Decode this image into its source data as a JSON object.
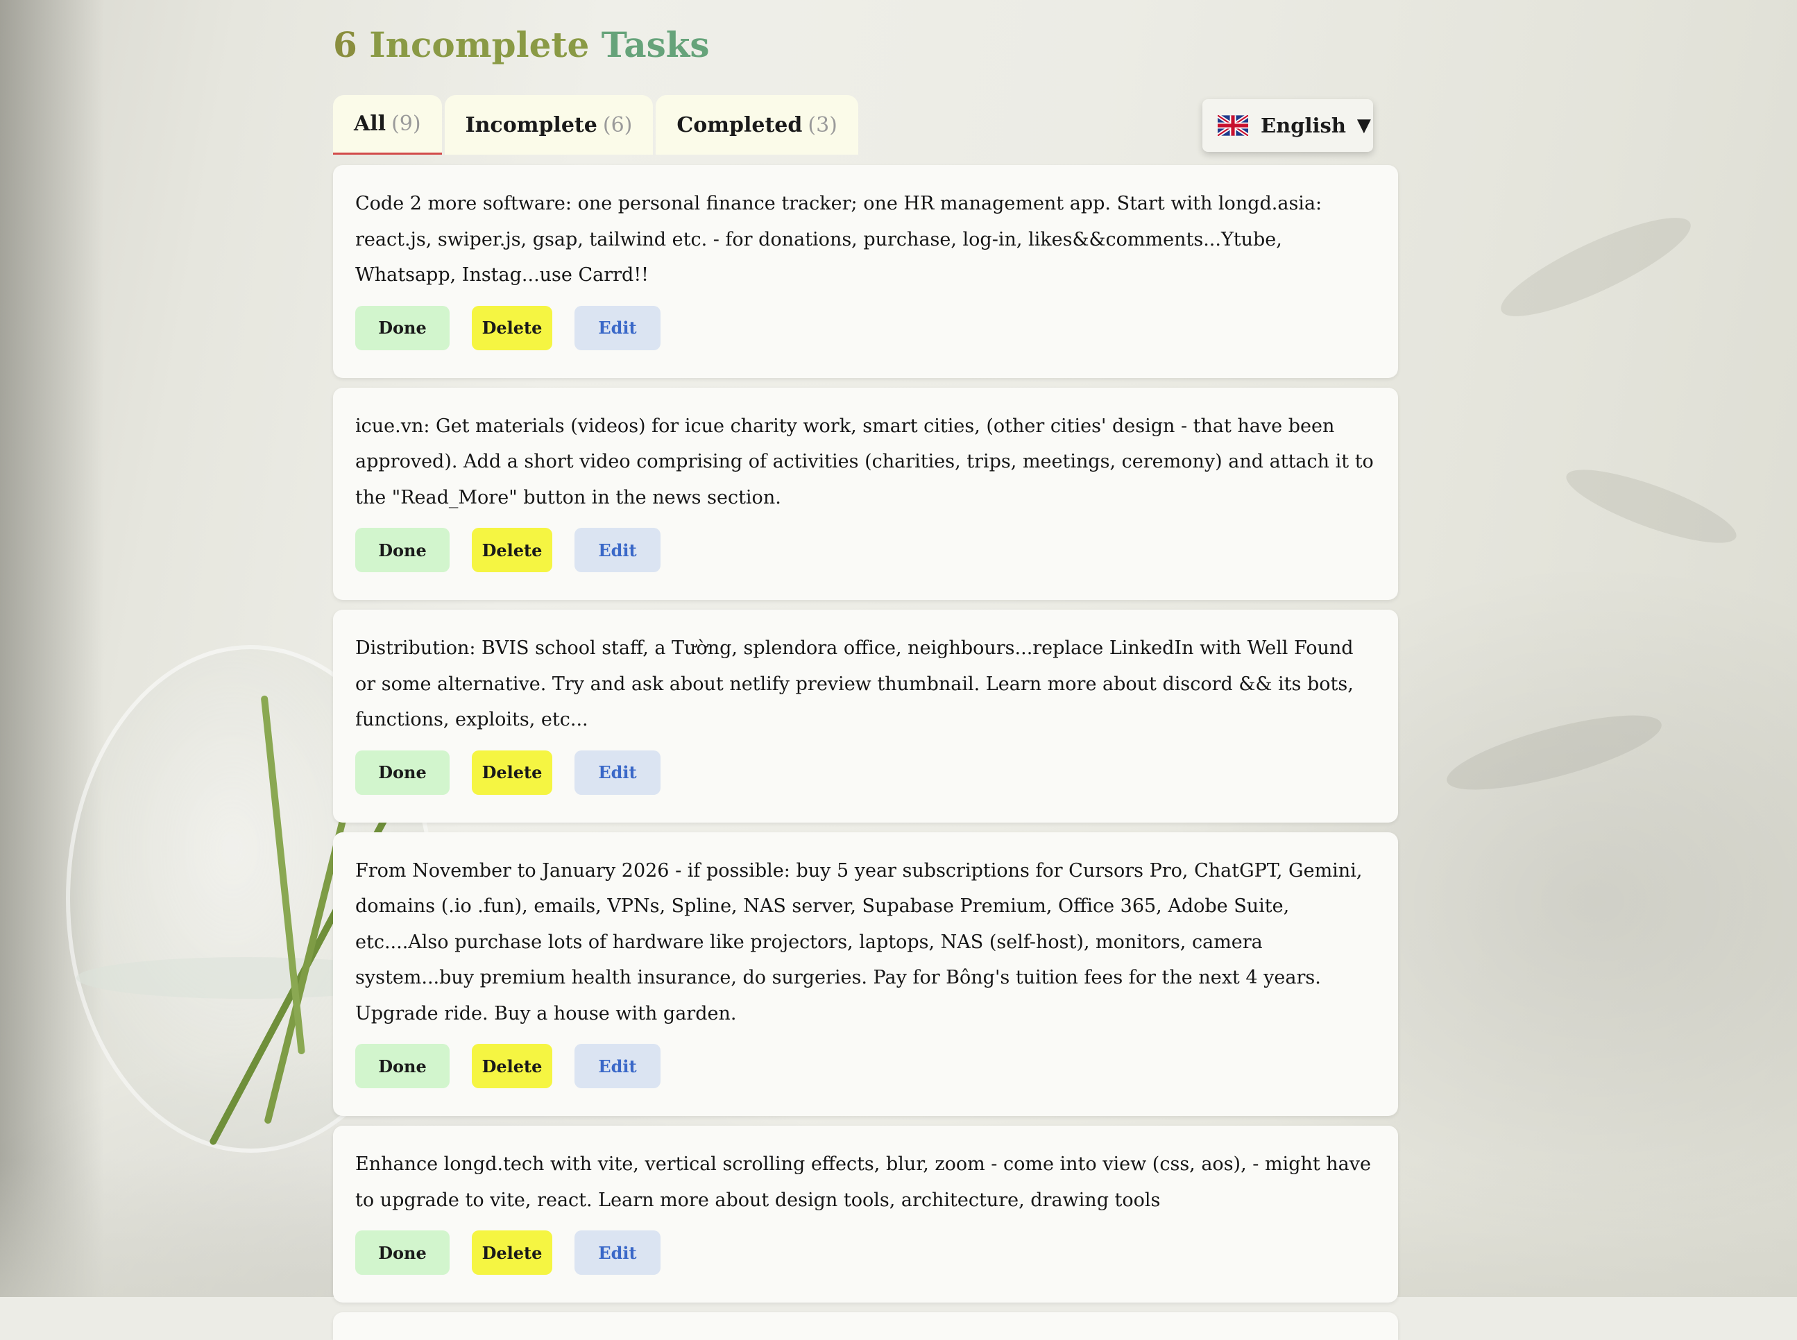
{
  "header": {
    "count": "6",
    "title_word1": "Incomplete",
    "title_word2": "Tasks"
  },
  "tabs": [
    {
      "label": "All",
      "count": "(9)",
      "active": true
    },
    {
      "label": "Incomplete",
      "count": "(6)",
      "active": false
    },
    {
      "label": "Completed",
      "count": "(3)",
      "active": false
    }
  ],
  "language": {
    "label": "English",
    "flag_icon": "uk-flag-icon",
    "caret": "▼"
  },
  "buttons": {
    "done": "Done",
    "delete": "Delete",
    "edit": "Edit"
  },
  "tasks": [
    {
      "text": "Code 2 more software: one personal finance tracker; one HR management app. Start with longd.asia: react.js, swiper.js, gsap, tailwind etc. - for donations, purchase, log-in, likes&&comments...Ytube, Whatsapp, Instag...use Carrd!!"
    },
    {
      "text": "icue.vn: Get materials (videos) for icue charity work, smart cities, (other cities' design - that have been approved). Add a short video comprising of activities (charities, trips, meetings, ceremony) and attach it to the \"Read_More\" button in the news section."
    },
    {
      "text": "Distribution: BVIS school staff, a Tường, splendora office, neighbours...replace LinkedIn with Well Found or some alternative. Try and ask about netlify preview thumbnail. Learn more about discord && its bots, functions, exploits, etc..."
    },
    {
      "text": "From November to January 2026 - if possible: buy 5 year subscriptions for Cursors Pro, ChatGPT, Gemini, domains (.io .fun), emails, VPNs, Spline, NAS server, Supabase Premium, Office 365, Adobe Suite, etc....Also purchase lots of hardware like projectors, laptops, NAS (self-host), monitors, camera system...buy premium health insurance, do surgeries. Pay for Bông's tuition fees for the next 4 years. Upgrade ride. Buy a house with garden."
    },
    {
      "text": "Enhance longd.tech with vite, vertical scrolling effects, blur, zoom - come into view (css, aos), - might have to upgrade to vite, react. Learn more about design tools, architecture, drawing tools"
    }
  ],
  "colors": {
    "title_count": "#8a8e3e",
    "title_word1": "#8a9a45",
    "title_word2": "#66a37a",
    "done_bg": "#d2f5cd",
    "delete_bg": "#f5f542",
    "edit_bg": "#dbe4f2",
    "edit_text": "#3a68c8",
    "active_tab_underline": "#d24a4a"
  }
}
